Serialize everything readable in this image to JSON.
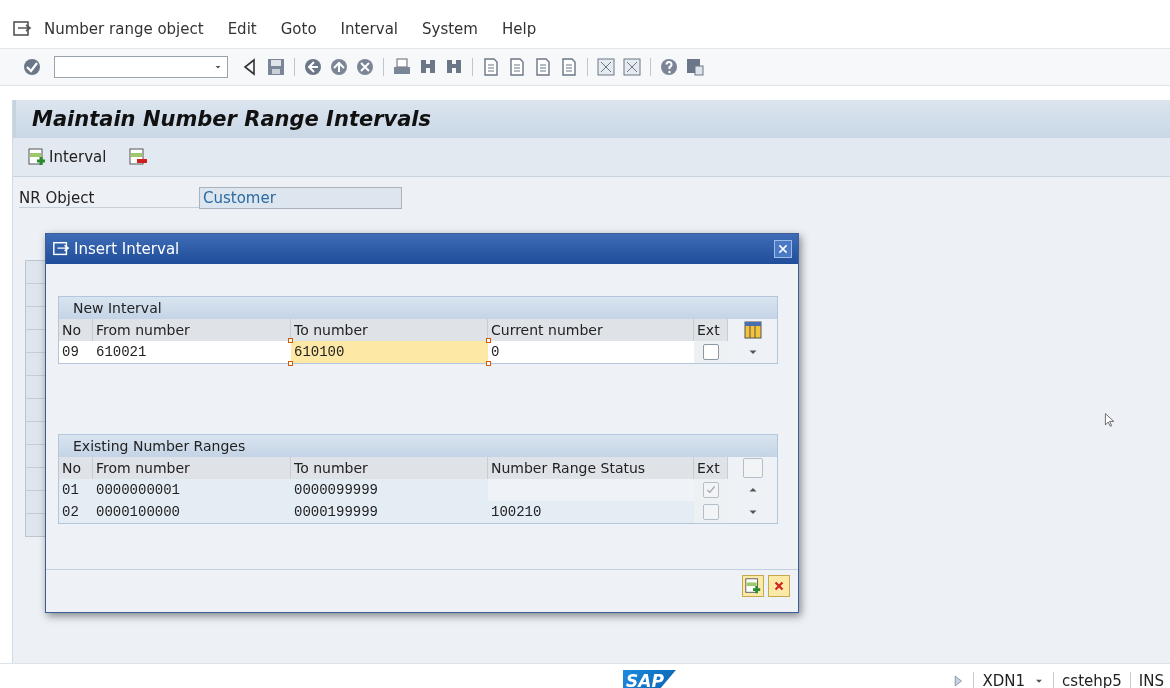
{
  "menu_bar": {
    "items": [
      "Number range object",
      "Edit",
      "Goto",
      "Interval",
      "System",
      "Help"
    ]
  },
  "screen": {
    "title": "Maintain Number Range Intervals",
    "app_toolbar": [
      {
        "kind": "insert",
        "label": "Interval"
      },
      {
        "kind": "delete"
      }
    ],
    "nr_object": {
      "label": "NR Object",
      "value": "Customer"
    }
  },
  "dialog": {
    "title": "Insert Interval",
    "new_interval": {
      "title": "New Interval",
      "columns": [
        "No",
        "From number",
        "To number",
        "Current number",
        "Ext"
      ],
      "rows": [
        {
          "cells": [
            {
              "text": "09",
              "focused": false
            },
            {
              "text": "610021",
              "focused": false
            },
            {
              "text": "610100",
              "focused": true
            },
            {
              "text": "0",
              "focused": false
            }
          ],
          "ext": false,
          "ext_disabled": false
        }
      ]
    },
    "existing": {
      "title": "Existing Number Ranges",
      "columns": [
        "No",
        "From number",
        "To number",
        "Number Range Status",
        "Ext"
      ],
      "rows": [
        {
          "cells": [
            {
              "text": "01"
            },
            {
              "text": "0000000001"
            },
            {
              "text": "0000099999"
            },
            {
              "empty": true
            }
          ],
          "ext": true,
          "ext_disabled": true
        },
        {
          "cells": [
            {
              "text": "02"
            },
            {
              "text": "0000100000"
            },
            {
              "text": "0000199999"
            },
            {
              "text": "100210"
            }
          ],
          "ext": false,
          "ext_disabled": true
        }
      ]
    }
  },
  "status_bar": {
    "logo": "SAP",
    "system": "XDN1",
    "client": "cstehp5",
    "mode": "INS"
  }
}
